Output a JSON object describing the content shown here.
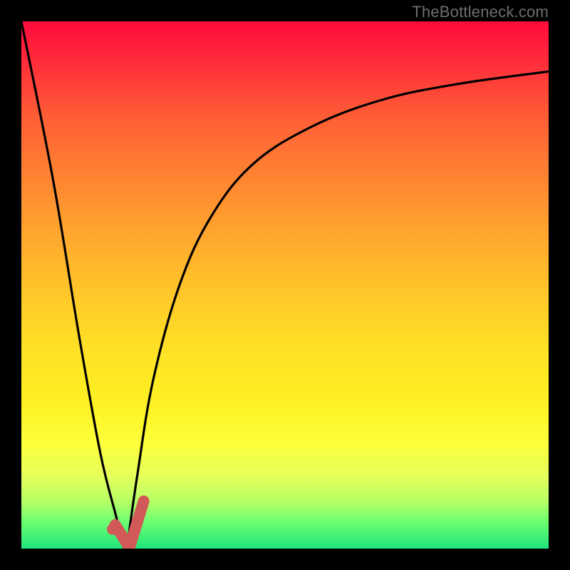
{
  "watermark": "TheBottleneck.com",
  "chart_data": {
    "type": "line",
    "title": "",
    "xlabel": "",
    "ylabel": "",
    "xlim": [
      0,
      100
    ],
    "ylim": [
      0,
      100
    ],
    "series": [
      {
        "name": "left-v-curve",
        "x": [
          0,
          6,
          11,
          15,
          18,
          19.5
        ],
        "values": [
          100,
          70,
          40,
          18,
          6,
          0
        ]
      },
      {
        "name": "right-rising-curve",
        "x": [
          20,
          22,
          25,
          30,
          36,
          44,
          55,
          68,
          82,
          100
        ],
        "values": [
          0,
          14,
          32,
          50,
          63,
          73,
          80,
          85,
          88,
          90.5
        ]
      }
    ],
    "marker": {
      "name": "indicator-dot",
      "x": 17.3,
      "y": 3.7,
      "color": "#d15a58"
    },
    "overlay_check": {
      "name": "check-glyph",
      "color": "#d15a58",
      "points_xy": [
        [
          17.8,
          4.5
        ],
        [
          20.5,
          0.2
        ],
        [
          23.2,
          9.0
        ]
      ],
      "stroke_width_px": 16
    },
    "gradient_stops": [
      {
        "pos": 0.0,
        "color": "#ff0a3c"
      },
      {
        "pos": 0.18,
        "color": "#ff5d36"
      },
      {
        "pos": 0.4,
        "color": "#ffa52e"
      },
      {
        "pos": 0.62,
        "color": "#ffe126"
      },
      {
        "pos": 0.8,
        "color": "#fcff3a"
      },
      {
        "pos": 0.95,
        "color": "#6cff70"
      },
      {
        "pos": 1.0,
        "color": "#20e47a"
      }
    ]
  }
}
